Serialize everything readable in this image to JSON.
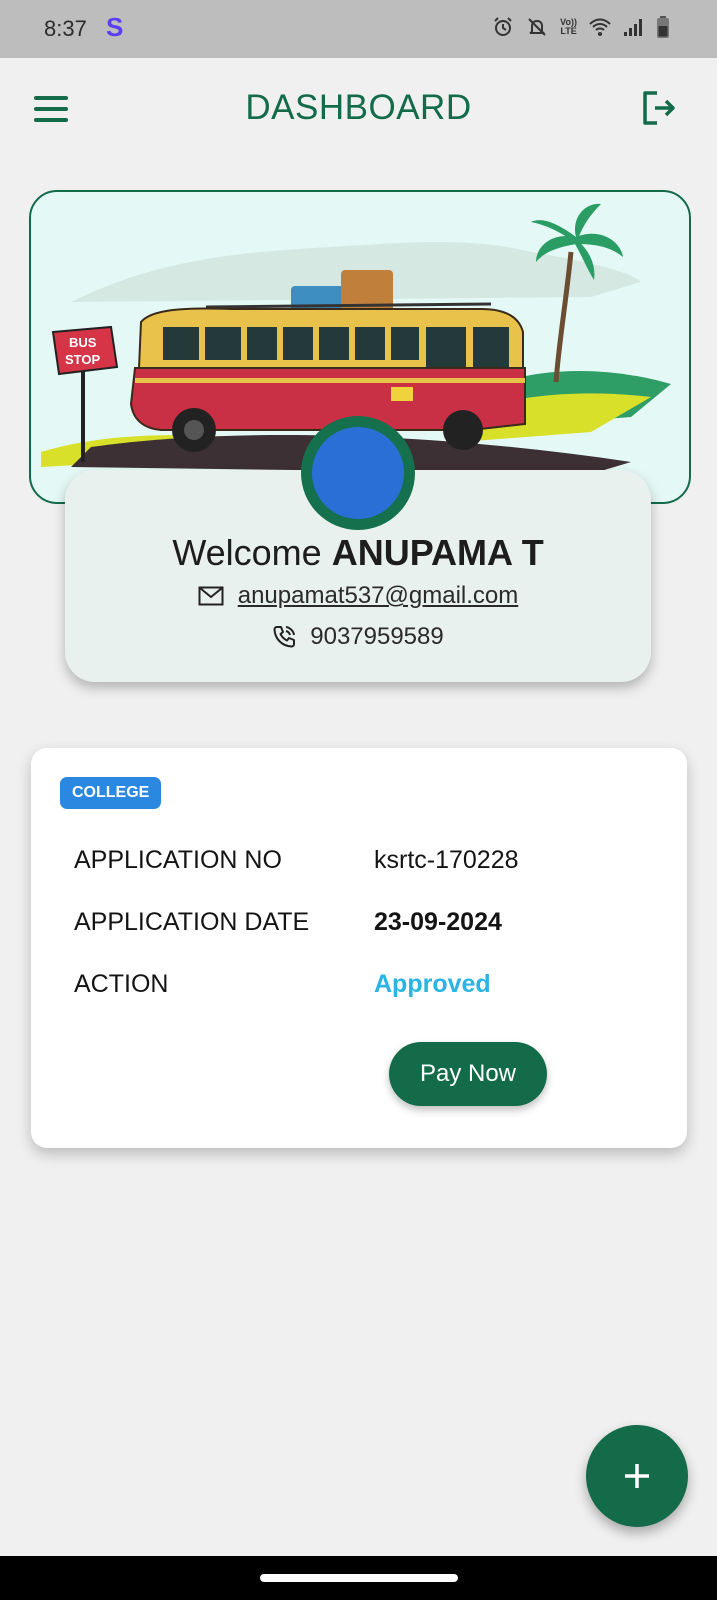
{
  "status_bar": {
    "time": "8:37",
    "app_letter": "S",
    "lte_top": "Vo))",
    "lte_bottom": "LTE"
  },
  "header": {
    "title": "DASHBOARD"
  },
  "banner": {
    "sign_line1": "BUS",
    "sign_line2": "STOP"
  },
  "profile": {
    "welcome_prefix": "Welcome ",
    "name": "ANUPAMA T",
    "email": "anupamat537@gmail.com",
    "phone": "9037959589"
  },
  "application": {
    "badge": "COLLEGE",
    "rows": [
      {
        "label": "APPLICATION NO",
        "value": "ksrtc-170228"
      },
      {
        "label": "APPLICATION DATE",
        "value": "23-09-2024"
      },
      {
        "label": "ACTION",
        "value": "Approved"
      }
    ],
    "pay_button": "Pay Now"
  },
  "colors": {
    "primary": "#136b4a",
    "badge": "#2b88e0",
    "approved": "#2bb3e2",
    "background": "#f0f0f0"
  },
  "icons": [
    "menu-icon",
    "logout-icon",
    "mail-icon",
    "phone-icon",
    "plus-icon",
    "alarm-icon",
    "bell-off-icon",
    "wifi-icon",
    "signal-icon",
    "battery-icon"
  ]
}
